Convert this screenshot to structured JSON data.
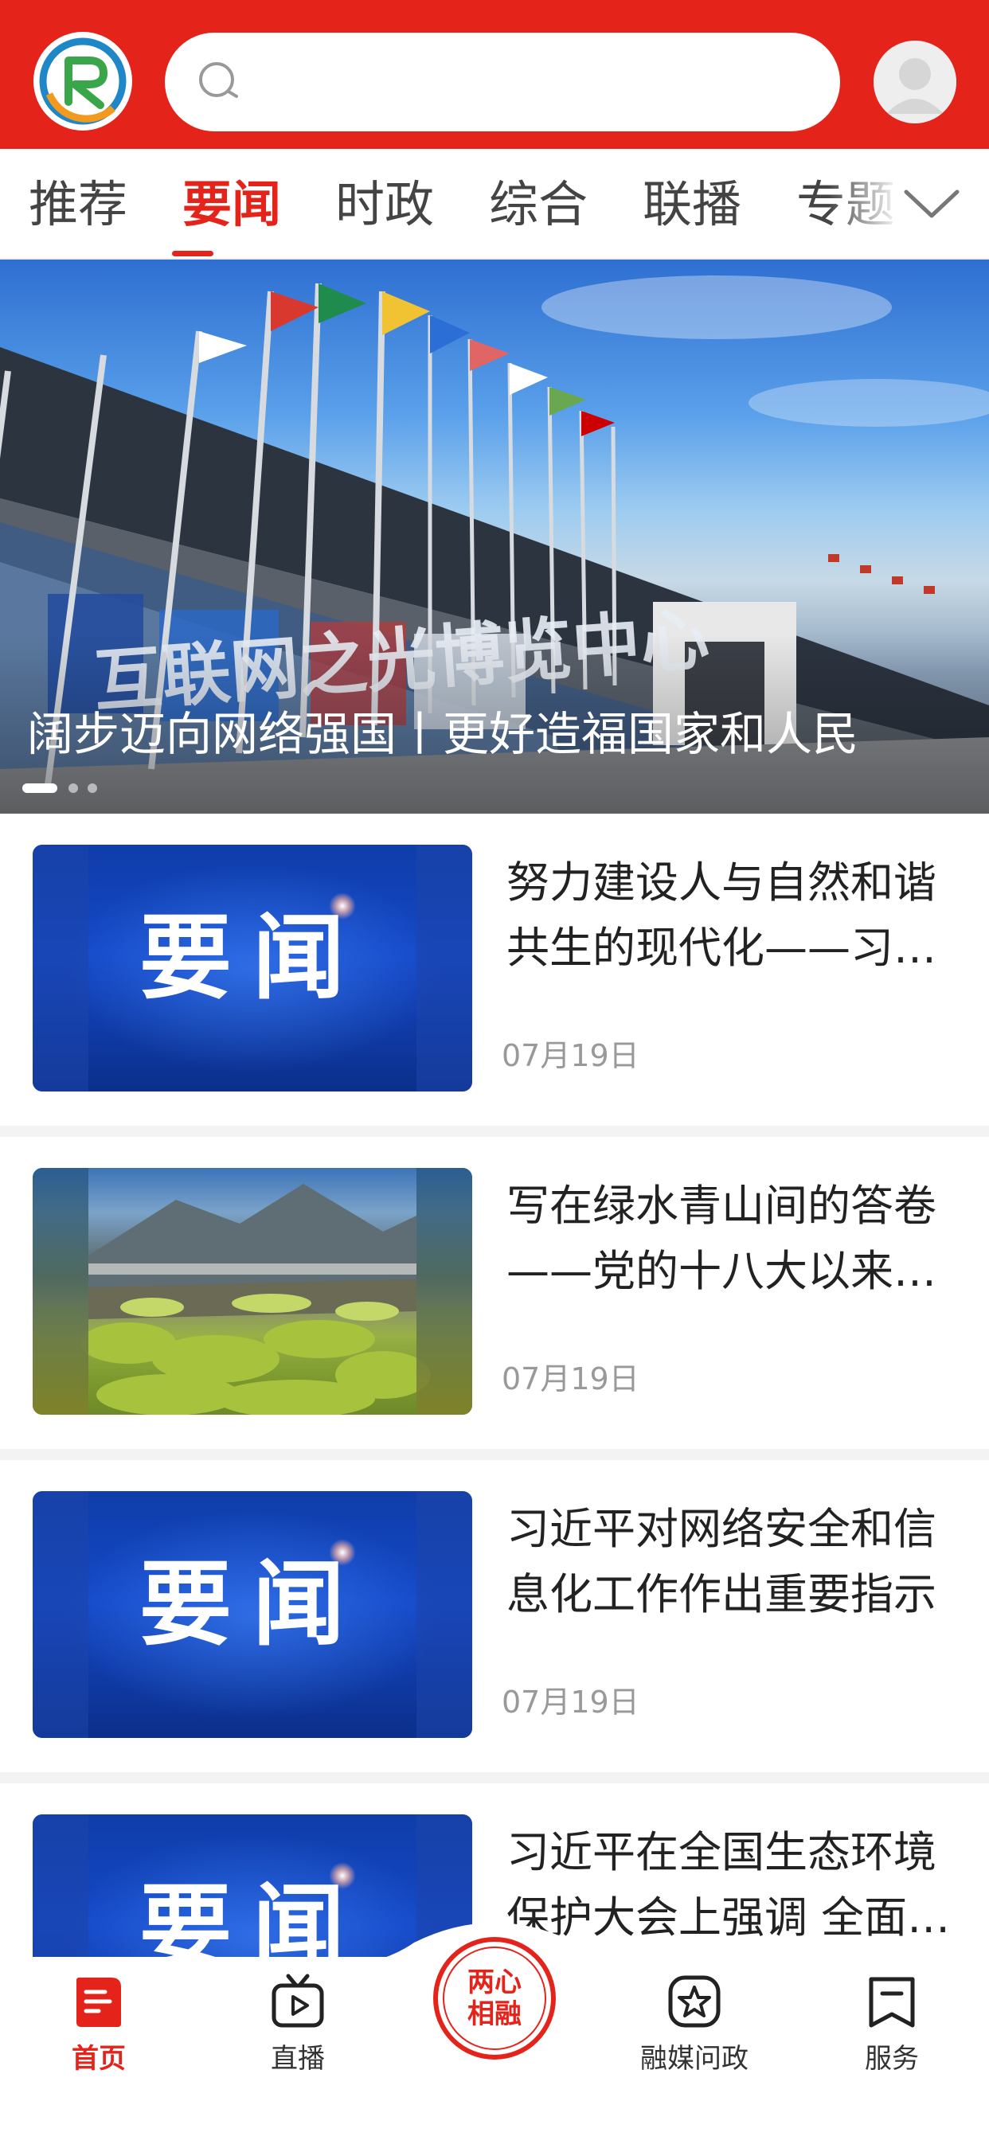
{
  "header": {
    "search": {
      "value": "",
      "placeholder": ""
    }
  },
  "tabs": [
    {
      "label": "推荐",
      "active": false
    },
    {
      "label": "要闻",
      "active": true
    },
    {
      "label": "时政",
      "active": false
    },
    {
      "label": "综合",
      "active": false
    },
    {
      "label": "联播",
      "active": false
    },
    {
      "label": "专题",
      "active": false
    }
  ],
  "banner": {
    "title": "阔步迈向网络强国丨更好造福国家和人民",
    "sign_text": "互联网之光博览中心",
    "slide_count": 3,
    "active_slide": 1
  },
  "news": [
    {
      "title": "努力建设人与自然和谐共生的现代化——习近平总书记指引生态文明建设",
      "date": "07月19日",
      "thumb_text": "要闻"
    },
    {
      "title": "写在绿水青山间的答卷——党的十八大以来生态文明建设成就综述",
      "date": "07月19日",
      "thumb_text": ""
    },
    {
      "title": "习近平对网络安全和信息化工作作出重要指示",
      "date": "07月19日",
      "thumb_text": "要闻"
    },
    {
      "title": "习近平在全国生态环境保护大会上强调 全面推进美丽中国建设",
      "date": "",
      "thumb_text": "要闻"
    }
  ],
  "bottom_nav": {
    "items": [
      {
        "label": "首页",
        "icon": "home-icon",
        "active": true
      },
      {
        "label": "直播",
        "icon": "tv-play-icon",
        "active": false
      },
      {
        "label": "融媒问政",
        "icon": "star-chat-icon",
        "active": false
      },
      {
        "label": "服务",
        "icon": "bookmark-icon",
        "active": false
      }
    ],
    "center": {
      "line1": "两心",
      "line2": "相融"
    }
  },
  "colors": {
    "brand_red": "#e4241b",
    "muted_text": "#999999",
    "yaowen_blue": "#1448c8"
  }
}
